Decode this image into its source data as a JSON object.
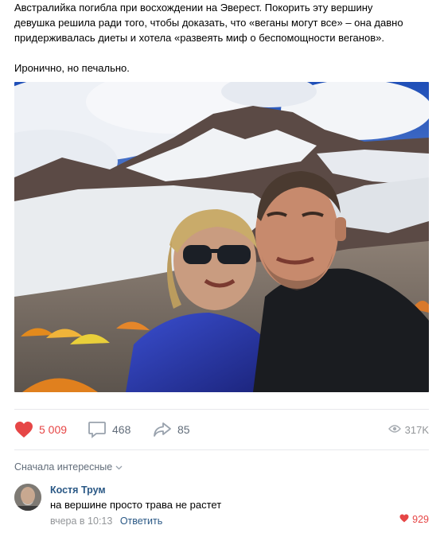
{
  "post": {
    "line1": "Австралийка погибла при восхождении на Эверест. Покорить эту вершину",
    "line2": "девушка решила ради того, чтобы доказать, что «веганы могут все» – она давно",
    "line3": "придерживалась диеты и хотела «развеять миф о беспомощности веганов».",
    "line4": "Иронично, но печально."
  },
  "actions": {
    "likes": "5 009",
    "comments": "468",
    "shares": "85",
    "views": "317K"
  },
  "comments_section": {
    "sort_label": "Сначала интересные",
    "comment": {
      "author": "Костя Трум",
      "text": "на вершине просто трава не растет",
      "time": "вчера в 10:13",
      "reply_label": "Ответить",
      "likes": "929"
    }
  },
  "colors": {
    "like_red": "#e64646",
    "link_blue": "#2a5885",
    "muted": "#939699"
  },
  "icons": {
    "like": "heart-icon",
    "comment": "comment-bubble-icon",
    "share": "share-arrow-icon",
    "views": "eye-icon",
    "sort": "chevron-down-icon"
  }
}
